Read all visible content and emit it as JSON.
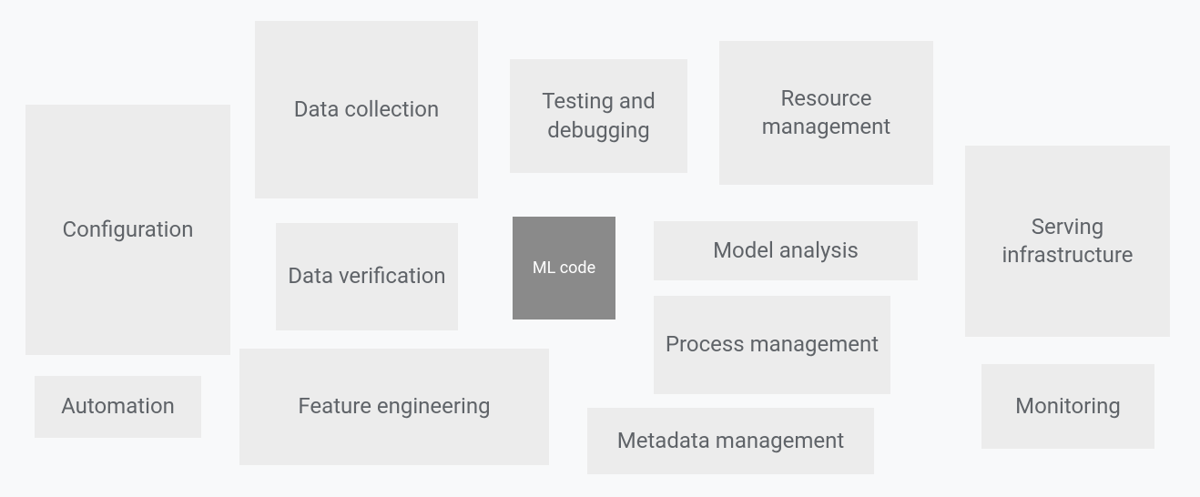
{
  "boxes": {
    "configuration": "Configuration",
    "automation": "Automation",
    "data_collection": "Data collection",
    "data_verification": "Data verification",
    "feature_engineering": "Feature engineering",
    "testing_debugging": "Testing and debugging",
    "ml_code": "ML code",
    "metadata_management": "Metadata management",
    "resource_management": "Resource management",
    "model_analysis": "Model analysis",
    "process_management": "Process management",
    "serving_infrastructure": "Serving infrastructure",
    "monitoring": "Monitoring"
  }
}
